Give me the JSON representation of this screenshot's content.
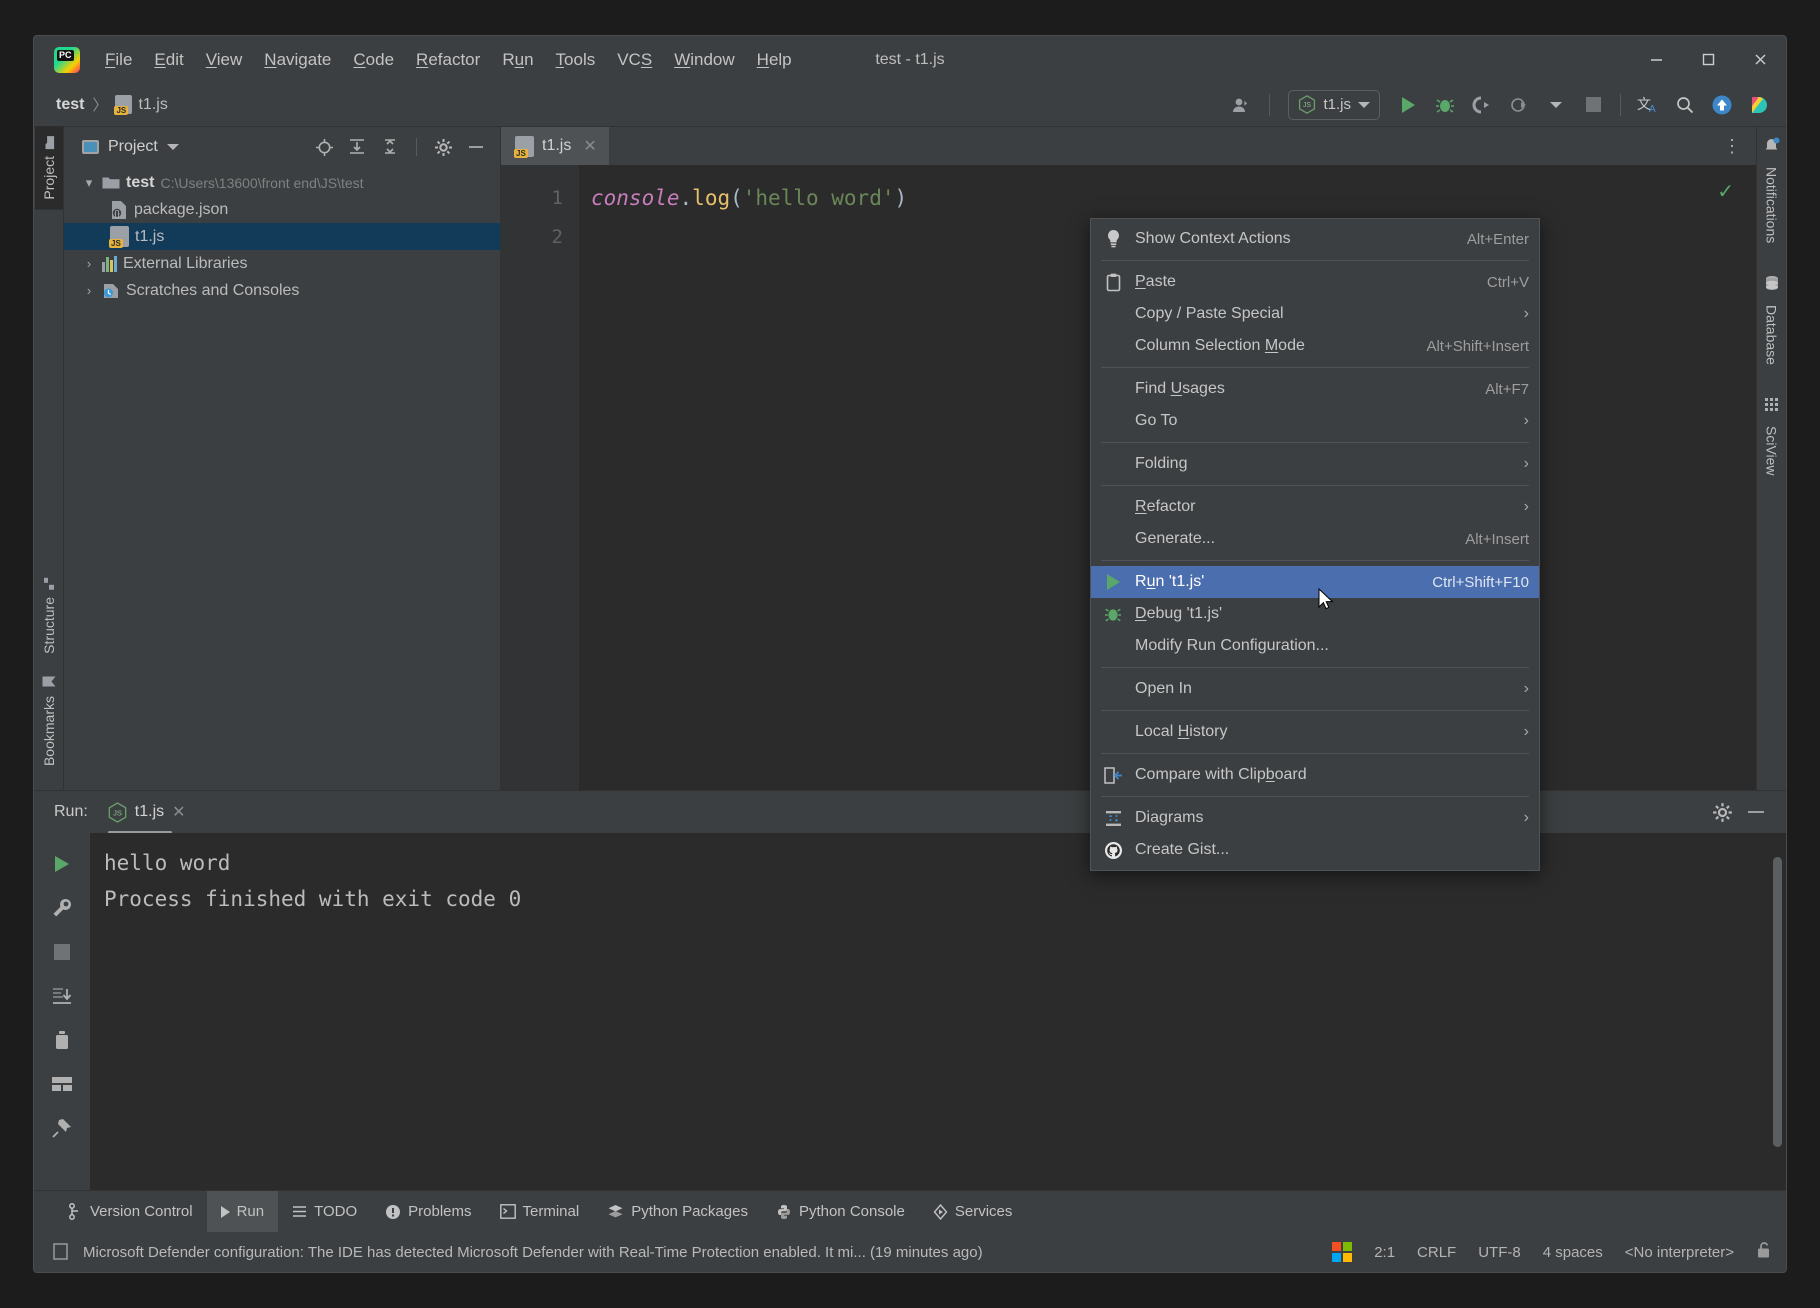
{
  "window": {
    "title": "test - t1.js",
    "app_icon": "pycharm-logo-icon",
    "controls": {
      "minimize": "─",
      "maximize": "☐",
      "close": "✕"
    }
  },
  "menubar": [
    {
      "label": "File",
      "mnemonic": "F"
    },
    {
      "label": "Edit",
      "mnemonic": "E"
    },
    {
      "label": "View",
      "mnemonic": "V"
    },
    {
      "label": "Navigate",
      "mnemonic": "N"
    },
    {
      "label": "Code",
      "mnemonic": "C"
    },
    {
      "label": "Refactor",
      "mnemonic": "R"
    },
    {
      "label": "Run",
      "mnemonic": "u"
    },
    {
      "label": "Tools",
      "mnemonic": "T"
    },
    {
      "label": "VCS",
      "mnemonic": "S"
    },
    {
      "label": "Window",
      "mnemonic": "W"
    },
    {
      "label": "Help",
      "mnemonic": "H"
    }
  ],
  "navbar": {
    "breadcrumb_project": "test",
    "breadcrumb_sep": "〉",
    "breadcrumb_file": "t1.js",
    "run_config": "t1.js",
    "buttons": [
      "profiler-icon",
      "run-icon",
      "debug-icon",
      "run-with-coverage-icon",
      "profile-icon",
      "stop-icon",
      "translate-icon",
      "search-everywhere-icon",
      "update-project-icon",
      "ide-feature-icon"
    ]
  },
  "left_strip": [
    {
      "label": "Project",
      "active": true
    },
    {
      "label": "Structure",
      "active": false
    },
    {
      "label": "Bookmarks",
      "active": false
    }
  ],
  "right_strip": [
    {
      "label": "Notifications"
    },
    {
      "label": "Database"
    },
    {
      "label": "SciView"
    }
  ],
  "project_panel": {
    "title": "Project",
    "actions": [
      "select-opened-file-icon",
      "expand-all-icon",
      "collapse-all-icon",
      "settings-icon",
      "hide-icon"
    ],
    "tree": [
      {
        "label": "test",
        "sublabel": "C:\\Users\\13600\\front end\\JS\\test",
        "icon": "folder-icon",
        "expanded": true,
        "depth": 0,
        "selected": false
      },
      {
        "label": "package.json",
        "sublabel": "",
        "icon": "json-file-icon",
        "expanded": null,
        "depth": 1,
        "selected": false
      },
      {
        "label": "t1.js",
        "sublabel": "",
        "icon": "js-file-icon",
        "expanded": null,
        "depth": 1,
        "selected": true
      },
      {
        "label": "External Libraries",
        "sublabel": "",
        "icon": "libraries-icon",
        "expanded": false,
        "depth": 0,
        "selected": false
      },
      {
        "label": "Scratches and Consoles",
        "sublabel": "",
        "icon": "scratches-icon",
        "expanded": false,
        "depth": 0,
        "selected": false
      }
    ]
  },
  "editor": {
    "tabs": [
      {
        "label": "t1.js",
        "icon": "js-file-icon",
        "close": "✕",
        "active": true
      }
    ],
    "kebab": "⋮",
    "line_numbers": [
      "1",
      "2"
    ],
    "code_tokens": [
      {
        "text": "console",
        "type": "object"
      },
      {
        "text": ".",
        "type": "punct"
      },
      {
        "text": "log",
        "type": "function"
      },
      {
        "text": "(",
        "type": "punct"
      },
      {
        "text": "'hello word'",
        "type": "string"
      },
      {
        "text": ")",
        "type": "punct"
      }
    ],
    "inspection_status": "✓"
  },
  "context_menu": {
    "items": [
      {
        "label": "Show Context Actions",
        "accel": "Alt+Enter",
        "icon": "lightbulb-icon",
        "submenu": false,
        "selected": false,
        "sep_after": true
      },
      {
        "label": "Paste",
        "mnemonic": "P",
        "accel": "Ctrl+V",
        "icon": "clipboard-icon",
        "submenu": false,
        "selected": false
      },
      {
        "label": "Copy / Paste Special",
        "accel": "",
        "icon": "",
        "submenu": true,
        "selected": false
      },
      {
        "label": "Column Selection Mode",
        "mnemonic": "M",
        "accel": "Alt+Shift+Insert",
        "icon": "",
        "submenu": false,
        "selected": false,
        "sep_after": true
      },
      {
        "label": "Find Usages",
        "mnemonic": "U",
        "accel": "Alt+F7",
        "icon": "",
        "submenu": false,
        "selected": false
      },
      {
        "label": "Go To",
        "accel": "",
        "icon": "",
        "submenu": true,
        "selected": false,
        "sep_after": true
      },
      {
        "label": "Folding",
        "accel": "",
        "icon": "",
        "submenu": true,
        "selected": false,
        "sep_after": true
      },
      {
        "label": "Refactor",
        "mnemonic": "R",
        "accel": "",
        "icon": "",
        "submenu": true,
        "selected": false
      },
      {
        "label": "Generate...",
        "accel": "Alt+Insert",
        "icon": "",
        "submenu": false,
        "selected": false,
        "sep_after": true
      },
      {
        "label": "Run 't1.js'",
        "mnemonic": "u",
        "accel": "Ctrl+Shift+F10",
        "icon": "run-icon",
        "submenu": false,
        "selected": true
      },
      {
        "label": "Debug 't1.js'",
        "mnemonic": "D",
        "accel": "",
        "icon": "debug-icon",
        "submenu": false,
        "selected": false
      },
      {
        "label": "Modify Run Configuration...",
        "accel": "",
        "icon": "",
        "submenu": false,
        "selected": false,
        "sep_after": true
      },
      {
        "label": "Open In",
        "accel": "",
        "icon": "",
        "submenu": true,
        "selected": false,
        "sep_after": true
      },
      {
        "label": "Local History",
        "mnemonic": "H",
        "accel": "",
        "icon": "",
        "submenu": true,
        "selected": false,
        "sep_after": true
      },
      {
        "label": "Compare with Clipboard",
        "mnemonic": "b",
        "accel": "",
        "icon": "compare-icon",
        "submenu": false,
        "selected": false,
        "sep_after": true
      },
      {
        "label": "Diagrams",
        "accel": "",
        "icon": "diagrams-icon",
        "submenu": true,
        "selected": false
      },
      {
        "label": "Create Gist...",
        "accel": "",
        "icon": "github-icon",
        "submenu": false,
        "selected": false
      }
    ]
  },
  "run_window": {
    "label": "Run:",
    "tab": "t1.js",
    "tab_close": "✕",
    "side_buttons": [
      "rerun-icon",
      "wrench-icon",
      "stop-icon",
      "scroll-to-end-icon",
      "trash-icon",
      "layout-icon",
      "pin-icon"
    ],
    "head_buttons": [
      "settings-icon",
      "hide-icon"
    ],
    "console_lines": [
      "hello word",
      "",
      "Process finished with exit code 0"
    ]
  },
  "bottom_tabs": [
    {
      "label": "Version Control",
      "icon": "branch-icon",
      "active": false
    },
    {
      "label": "Run",
      "icon": "run-icon",
      "active": true
    },
    {
      "label": "TODO",
      "icon": "list-icon",
      "active": false
    },
    {
      "label": "Problems",
      "icon": "warning-icon",
      "active": false
    },
    {
      "label": "Terminal",
      "icon": "terminal-icon",
      "active": false
    },
    {
      "label": "Python Packages",
      "icon": "packages-icon",
      "active": false
    },
    {
      "label": "Python Console",
      "icon": "python-icon",
      "active": false
    },
    {
      "label": "Services",
      "icon": "services-icon",
      "active": false
    }
  ],
  "status_bar": {
    "message": "Microsoft Defender configuration: The IDE has detected Microsoft Defender with Real-Time Protection enabled. It mi... (19 minutes ago)",
    "right": {
      "os_icon": "windows-logo-icon",
      "caret": "2:1",
      "line_sep": "CRLF",
      "encoding": "UTF-8",
      "indent": "4 spaces",
      "interpreter": "<No interpreter>",
      "lock": "unlocked-icon"
    }
  },
  "colors": {
    "accent_blue": "#4b6eaf",
    "bg_panel": "#3c3f41",
    "bg_editor": "#2b2b2b",
    "green": "#59a869",
    "selection_tree": "#123a59"
  }
}
